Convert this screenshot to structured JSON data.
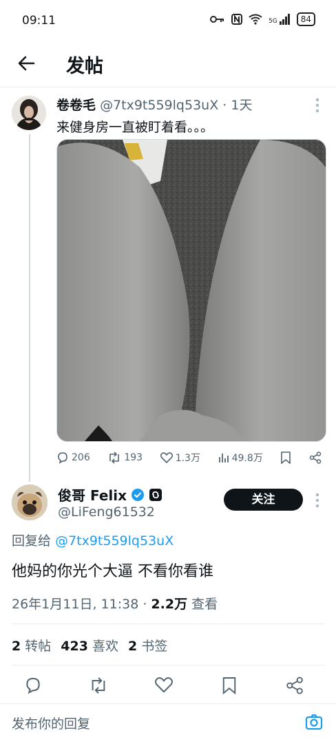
{
  "status": {
    "time": "09:11",
    "network": "5G",
    "battery": "84"
  },
  "nav": {
    "title": "发帖"
  },
  "original_post": {
    "author": "卷卷毛",
    "handle": "@7tx9t559lq53uX",
    "time_sep": "·",
    "time": "1天",
    "text": "来健身房一直被盯着看。。。",
    "stats": {
      "replies": "206",
      "reposts": "193",
      "likes": "1.3万",
      "views": "49.8万"
    }
  },
  "reply": {
    "name": "俊哥 Felix",
    "handle": "@LiFeng61532",
    "follow_label": "关注",
    "reply_to_label": "回复给",
    "reply_to_handle": "@7tx9t559lq53uX",
    "text": "他妈的你光个大逼 不看你看谁",
    "date": "26年1月11日, 11:38 · ",
    "views_count": "2.2万",
    "views_label": " 查看",
    "reposts_count": "2",
    "reposts_label": "转帖",
    "likes_count": "423",
    "likes_label": "喜欢",
    "bookmarks_count": "2",
    "bookmarks_label": "书签"
  },
  "compose": {
    "placeholder": "发布你的回复"
  },
  "colors": {
    "accent": "#1d9bf0",
    "text": "#0f1419",
    "muted": "#536471",
    "border": "#e6ecf0"
  }
}
